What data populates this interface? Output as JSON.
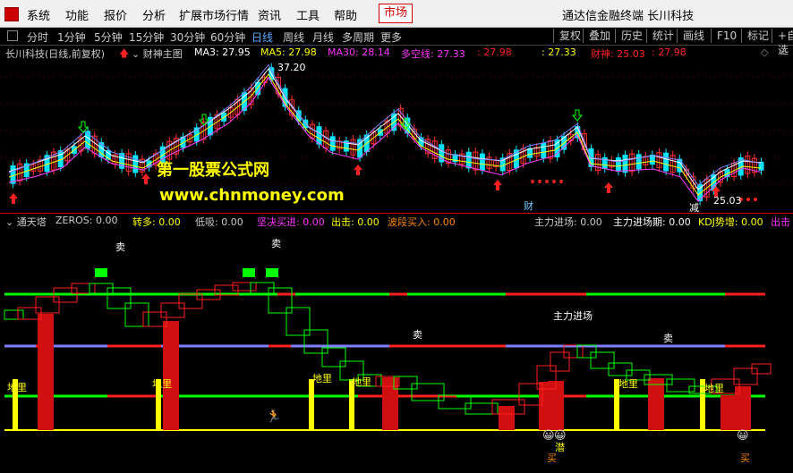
{
  "menu": {
    "items": [
      "系统",
      "功能",
      "报价",
      "分析",
      "扩展市场行情",
      "资讯",
      "工具",
      "帮助"
    ],
    "market": "市场",
    "title": "通达信金融终端 长川科技"
  },
  "toolbar": {
    "periods": [
      "分时",
      "1分钟",
      "5分钟",
      "15分钟",
      "30分钟",
      "60分钟",
      "日线",
      "周线",
      "月线",
      "多周期",
      "更多"
    ],
    "selected": "日线",
    "right": [
      "复权",
      "叠加",
      "历史",
      "统计",
      "画线",
      "F10",
      "标记",
      "+自选"
    ]
  },
  "main_header": {
    "stock": "长川科技(日线,前复权)",
    "indicator": "财神主图",
    "ma3": "MA3: 27.95",
    "ma5": "MA5: 27.98",
    "ma30": "MA30: 28.14",
    "duo": "多空线: 27.33",
    "v1": ": 27.98",
    "v2": ": 27.33",
    "caishen": "财神: 25.03",
    "v3": ": 27.98"
  },
  "chart_labels": {
    "high": "37.20",
    "low": "25.03",
    "cai": "财",
    "jian": "减"
  },
  "watermark": {
    "line1": "第一股票公式网",
    "line2": "www.chnmoney.com"
  },
  "sub_header": {
    "name": "通天塔",
    "zeros": "ZEROS: 0.00",
    "zhuanduo": "转多: 0.00",
    "dixi": "低吸: 0.00",
    "jianjue": "坚决买进: 0.00",
    "chuji": "出击: 0.00",
    "boduan": "波段买入: 0.00",
    "zljc": "主力进场: 0.00",
    "zljcq": "主力进场期: 0.00",
    "kdj": "KDJ势增: 0.00",
    "chuji2": "出击"
  },
  "sub_labels": {
    "sell": "卖",
    "diligang": "地里",
    "zhuli": "主力进场",
    "buy": "买",
    "qian": "潜"
  },
  "colors": {
    "up": "#ff3030",
    "down": "#00e5ff",
    "green": "#00ff00",
    "red": "#ff2020",
    "yellow": "#ffff00",
    "blue": "#8080ff"
  }
}
